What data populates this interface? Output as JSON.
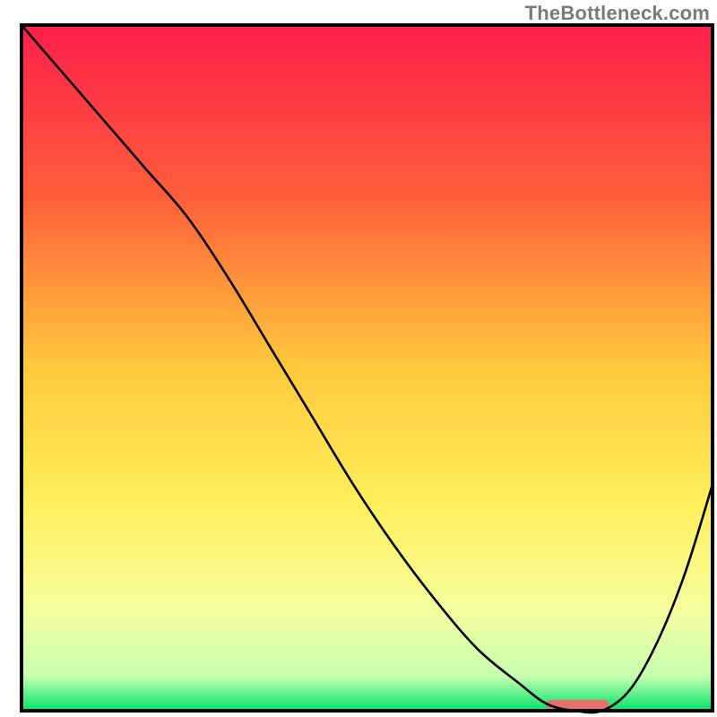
{
  "watermark": "TheBottleneck.com",
  "chart_data": {
    "type": "line",
    "title": "",
    "xlabel": "",
    "ylabel": "",
    "xlim": [
      0,
      100
    ],
    "ylim": [
      0,
      100
    ],
    "gradient_stops": [
      {
        "offset": 0.0,
        "color": "#ff1f4b"
      },
      {
        "offset": 0.25,
        "color": "#ff5e3a"
      },
      {
        "offset": 0.5,
        "color": "#ffc93c"
      },
      {
        "offset": 0.7,
        "color": "#ffef5c"
      },
      {
        "offset": 0.85,
        "color": "#f6ff9e"
      },
      {
        "offset": 0.95,
        "color": "#c6ffb0"
      },
      {
        "offset": 1.0,
        "color": "#00e36b"
      }
    ],
    "series": [
      {
        "name": "bottleneck-curve",
        "x": [
          0,
          6,
          12,
          18,
          24,
          30,
          36,
          42,
          48,
          54,
          60,
          66,
          72,
          76,
          80,
          84,
          88,
          92,
          96,
          100
        ],
        "y": [
          100,
          93,
          86,
          79,
          72,
          63,
          53,
          43,
          33,
          24,
          16,
          9,
          4,
          1,
          0,
          0,
          3,
          10,
          20,
          33
        ]
      }
    ],
    "highlight_bar": {
      "x_start": 76,
      "x_end": 85,
      "color": "#e96f6f"
    },
    "frame_color": "#000000",
    "line_color": "#000000",
    "line_width": 2.6
  }
}
